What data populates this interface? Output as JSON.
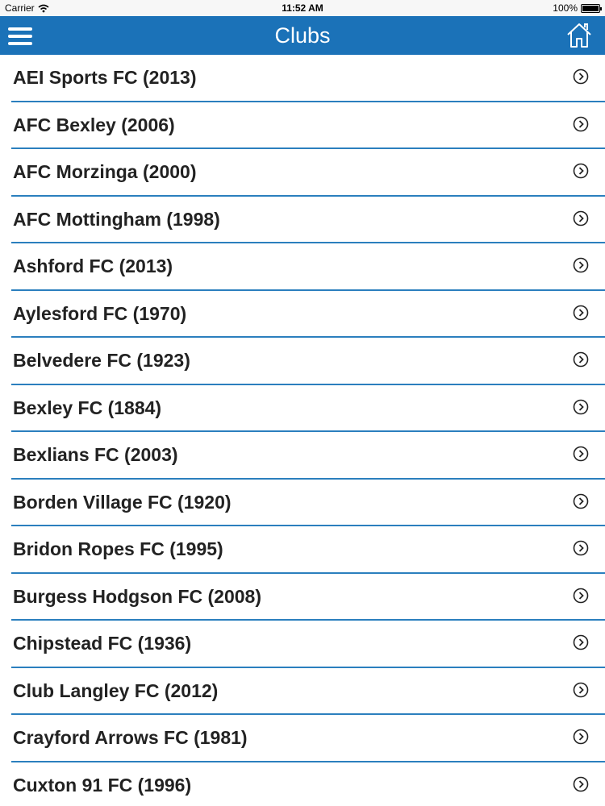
{
  "status_bar": {
    "carrier": "Carrier",
    "time": "11:52 AM",
    "battery": "100%",
    "battery_level": 1.0
  },
  "navbar": {
    "title": "Clubs",
    "menu_icon": "hamburger-menu-icon",
    "home_icon": "home-icon",
    "color": "#1b72b8"
  },
  "clubs": [
    {
      "label": "AEI Sports FC (2013)"
    },
    {
      "label": "AFC Bexley (2006)"
    },
    {
      "label": "AFC Morzinga (2000)"
    },
    {
      "label": "AFC Mottingham (1998)"
    },
    {
      "label": "Ashford FC (2013)"
    },
    {
      "label": "Aylesford FC (1970)"
    },
    {
      "label": "Belvedere FC (1923)"
    },
    {
      "label": "Bexley FC (1884)"
    },
    {
      "label": "Bexlians FC (2003)"
    },
    {
      "label": "Borden Village FC (1920)"
    },
    {
      "label": "Bridon Ropes FC (1995)"
    },
    {
      "label": "Burgess Hodgson FC (2008)"
    },
    {
      "label": "Chipstead FC (1936)"
    },
    {
      "label": "Club Langley FC (2012)"
    },
    {
      "label": "Crayford Arrows FC (1981)"
    },
    {
      "label": "Cuxton 91 FC (1996)"
    }
  ],
  "row_icon": "chevron-right-circle-icon",
  "divider_color": "#2b7fbe"
}
